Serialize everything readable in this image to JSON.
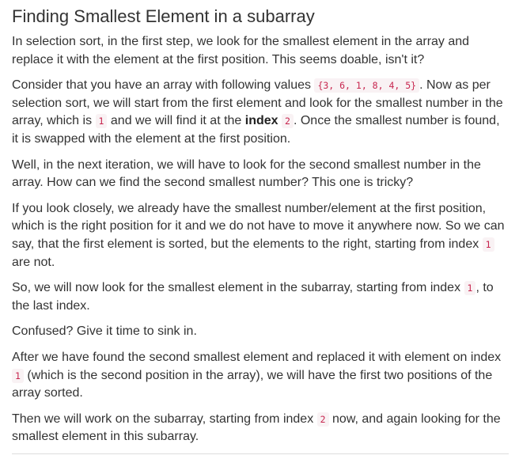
{
  "title": "Finding Smallest Element in a subarray",
  "p1": "In selection sort, in the first step, we look for the smallest element in the array and replace it with the element at the first position. This seems doable, isn't it?",
  "p2": {
    "t1": "Consider that you have an array with following values ",
    "c1": "{3, 6, 1, 8, 4, 5}",
    "t2": ". Now as per selection sort, we will start from the first element and look for the smallest number in the array, which is ",
    "c2": "1",
    "t3": " and we will find it at the ",
    "b1": "index",
    "t4": " ",
    "c3": "2",
    "t5": ". Once the smallest number is found, it is swapped with the element at the first position."
  },
  "p3": "Well, in the next iteration, we will have to look for the second smallest number in the array. How can we find the second smallest number? This one is tricky?",
  "p4": {
    "t1": "If you look closely, we already have the smallest number/element at the first position, which is the right position for it and we do not have to move it anywhere now. So we can say, that the first element is sorted, but the elements to the right, starting from index ",
    "c1": "1",
    "t2": " are not."
  },
  "p5": {
    "t1": "So, we will now look for the smallest element in the subarray, starting from index ",
    "c1": "1",
    "t2": ", to the last index."
  },
  "p6": "Confused? Give it time to sink in.",
  "p7": {
    "t1": "After we have found the second smallest element and replaced it with element on index ",
    "c1": "1",
    "t2": " (which is the second position in the array), we will have the first two positions of the array sorted."
  },
  "p8": {
    "t1": "Then we will work on the subarray, starting from index ",
    "c1": "2",
    "t2": " now, and again looking for the smallest element in this subarray."
  },
  "colors": {
    "text": "#333333",
    "code_text": "#c7254e",
    "code_bg": "#f9f2f4",
    "rule": "#dddddd"
  }
}
